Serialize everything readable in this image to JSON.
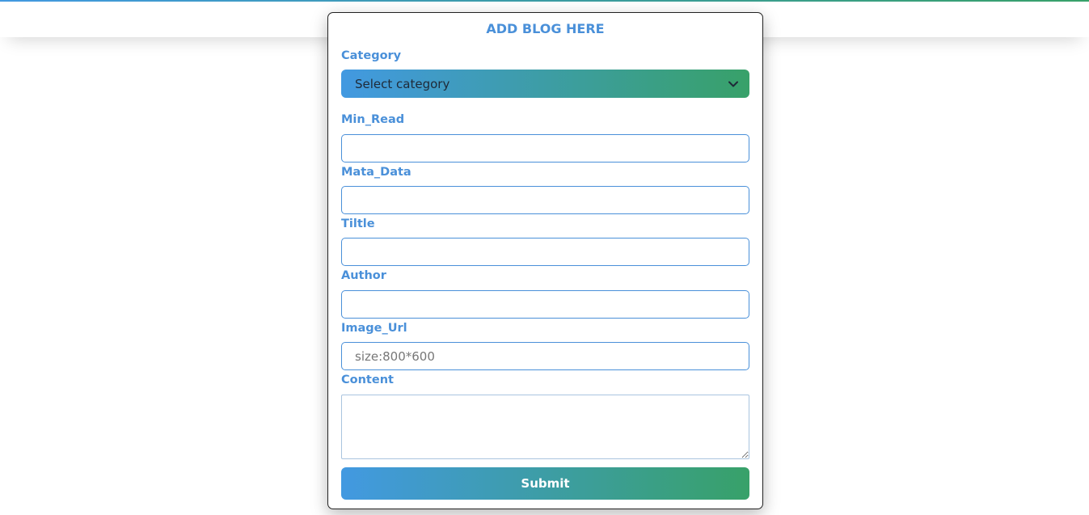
{
  "colors": {
    "accent": "#4a90d9",
    "gradient_start": "#4299e1",
    "gradient_end": "#38a169"
  },
  "form": {
    "heading": "ADD BLOG HERE",
    "category": {
      "label": "Category",
      "selected": "Select category",
      "icon": "chevron-down-icon"
    },
    "min_read": {
      "label": "Min_Read",
      "value": "",
      "placeholder": ""
    },
    "meta_data": {
      "label": "Mata_Data",
      "value": "",
      "placeholder": ""
    },
    "title": {
      "label": "Tiltle",
      "value": "",
      "placeholder": ""
    },
    "author": {
      "label": "Author",
      "value": "",
      "placeholder": ""
    },
    "image_url": {
      "label": "Image_Url",
      "value": "",
      "placeholder": "size:800*600"
    },
    "content": {
      "label": "Content",
      "value": ""
    },
    "submit_label": "Submit"
  }
}
